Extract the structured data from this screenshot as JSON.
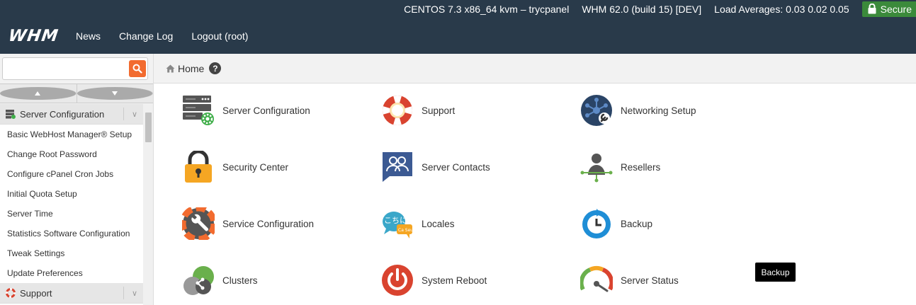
{
  "header": {
    "server_info": "CENTOS 7.3 x86_64 kvm – trycpanel",
    "version": "WHM 62.0 (build 15) [DEV]",
    "load_averages": "Load Averages: 0.03 0.02 0.05",
    "secure_label": "Secure",
    "logo": "WHM",
    "nav": [
      "News",
      "Change Log",
      "Logout (root)"
    ],
    "bar_color": "#293a4a",
    "secure_color": "#3b8a3b"
  },
  "sidebar": {
    "search": {
      "value": "",
      "placeholder": ""
    },
    "search_button_icon": "search-icon",
    "categories": [
      {
        "label": "Server Configuration",
        "icon": "server-config-icon",
        "items": [
          "Basic WebHost Manager® Setup",
          "Change Root Password",
          "Configure cPanel Cron Jobs",
          "Initial Quota Setup",
          "Server Time",
          "Statistics Software Configuration",
          "Tweak Settings",
          "Update Preferences"
        ]
      },
      {
        "label": "Support",
        "icon": "lifebuoy-icon",
        "items": []
      }
    ]
  },
  "breadcrumb": {
    "home": "Home",
    "help": "?"
  },
  "tiles": [
    {
      "label": "Server Configuration",
      "icon": "server-config-icon"
    },
    {
      "label": "Support",
      "icon": "lifebuoy-icon"
    },
    {
      "label": "Networking Setup",
      "icon": "network-icon"
    },
    {
      "label": "Security Center",
      "icon": "padlock-icon"
    },
    {
      "label": "Server Contacts",
      "icon": "contacts-icon"
    },
    {
      "label": "Resellers",
      "icon": "reseller-icon"
    },
    {
      "label": "Service Configuration",
      "icon": "wrench-icon"
    },
    {
      "label": "Locales",
      "icon": "locales-icon"
    },
    {
      "label": "Backup",
      "icon": "backup-icon"
    },
    {
      "label": "Clusters",
      "icon": "clusters-icon"
    },
    {
      "label": "System Reboot",
      "icon": "power-icon"
    },
    {
      "label": "Server Status",
      "icon": "gauge-icon"
    }
  ],
  "tooltip": "Backup",
  "accent_color": "#f26b2f"
}
